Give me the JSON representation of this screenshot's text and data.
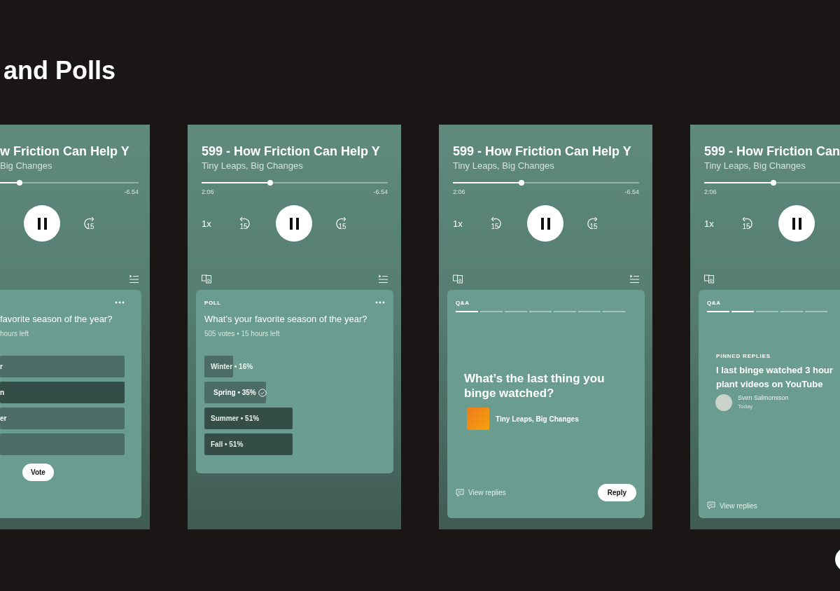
{
  "heading": "and Polls",
  "phones": [
    {
      "kind": "cut_left",
      "title": "w Friction Can Help Y",
      "show": "Big Changes",
      "level": 0.14,
      "remaining": "-6.54",
      "skip_forward": "15",
      "queue_icon": true,
      "card": {
        "kind": "poll",
        "more_menu": true,
        "question": "favorite season of the year?",
        "meta": "hours left",
        "options": [
          {
            "label": "r",
            "selected": false
          },
          {
            "label": "n",
            "selected": true
          },
          {
            "label": "er",
            "selected": false
          },
          {
            "selected": false
          }
        ],
        "button": "Vote"
      }
    },
    {
      "kind": "full",
      "title": "599 - How Friction Can Help Y",
      "show": "Tiny Leaps, Big Changes",
      "level": 0.37,
      "elapsed": "2:06",
      "remaining": "-6.54",
      "speed": "1x",
      "skip_back": "15",
      "skip_forward": "15",
      "devices_icon": true,
      "queue_icon": true,
      "card": {
        "kind": "poll_results",
        "label": "POLL",
        "more_menu": true,
        "question": "What’s your favorite season of the year?",
        "meta": "505 votes • 15 hours left",
        "results": [
          {
            "label": "Winter • 16%",
            "level": 0.16,
            "selected": false,
            "leading": false
          },
          {
            "label": "Spring • 35%",
            "level": 0.34,
            "selected": true,
            "leading": false
          },
          {
            "label": "Summer • 51%",
            "level": 0.49,
            "selected": false,
            "leading": true
          },
          {
            "label": "Fall • 51%",
            "level": 0.49,
            "selected": false,
            "leading": true
          }
        ]
      }
    },
    {
      "kind": "full",
      "title": "599 - How Friction Can Help Y",
      "show": "Tiny Leaps, Big Changes",
      "level": 0.37,
      "elapsed": "2:06",
      "remaining": "-6.54",
      "speed": "1x",
      "skip_back": "15",
      "skip_forward": "15",
      "devices_icon": true,
      "queue_icon": true,
      "card": {
        "kind": "question",
        "label": "Q&A",
        "segments": [
          {
            "filled": true
          },
          {
            "filled": false
          },
          {
            "filled": false
          },
          {
            "filled": false
          },
          {
            "filled": false
          },
          {
            "filled": false
          },
          {
            "filled": false
          }
        ],
        "question": "What’s the last thing you binge watched?",
        "show": "Tiny Leaps, Big Changes",
        "link": "View replies",
        "button": "Reply"
      }
    },
    {
      "kind": "cut_right",
      "title": "599 - How Friction Can",
      "show": "Tiny Leaps, Big Changes",
      "level": 0.51,
      "elapsed": "2:06",
      "speed": "1x",
      "skip_back": "15",
      "devices_icon": true,
      "card": {
        "kind": "pinned",
        "label": "Q&A",
        "segments": [
          {
            "filled": true
          },
          {
            "filled": true
          },
          {
            "filled": false
          },
          {
            "filled": false
          },
          {
            "filled": false
          }
        ],
        "section": "PINNED REPLIES",
        "reply_lines": [
          "I last binge watched 3 hour",
          "plant videos on YouTube"
        ],
        "author": "Sven Salmonsson",
        "time": "Today",
        "link": "View replies"
      }
    }
  ],
  "corner_button": true
}
